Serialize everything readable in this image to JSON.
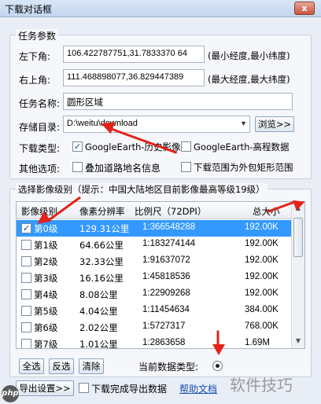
{
  "window": {
    "title": "下载对话框",
    "close_label": "x"
  },
  "task": {
    "legend": "任务参数",
    "bottom_left_label": "左下角:",
    "bottom_left_value": "106.422787751,31.7833370 64",
    "bottom_left_hint": "(最小经度,最小纬度)",
    "top_right_label": "右上角:",
    "top_right_value": "111.468898077,36.829447389",
    "top_right_hint": "(最大经度,最大纬度)",
    "name_label": "任务名称:",
    "name_value": "圆形区域",
    "dir_label": "存储目录:",
    "dir_value": "D:\\weitu\\download",
    "browse_label": "浏览>>",
    "type_label": "下载类型:",
    "type_option_1": "GoogleEarth-历史影像",
    "type_option_2": "GoogleEarth-高程数据",
    "other_label": "其他选项:",
    "other_option_1": "叠加道路地名信息",
    "other_option_2": "下载范围为外包矩形范围"
  },
  "levels": {
    "legend": "选择影像级别（提示：中国大陆地区目前影像最高等级19级）",
    "columns": [
      "影像级别",
      "像素分辨率",
      "比例尺（72DPI）",
      "总大小"
    ],
    "rows": [
      {
        "level": "第0级",
        "res": "129.31公里",
        "scale": "1:366548288",
        "size": "192.00K",
        "checked": true,
        "selected": true
      },
      {
        "level": "第1级",
        "res": "64.66公里",
        "scale": "1:183274144",
        "size": "192.00K",
        "checked": false,
        "selected": false
      },
      {
        "level": "第2级",
        "res": "32.33公里",
        "scale": "1:91637072",
        "size": "192.00K",
        "checked": false,
        "selected": false
      },
      {
        "level": "第3级",
        "res": "16.16公里",
        "scale": "1:45818536",
        "size": "192.00K",
        "checked": false,
        "selected": false
      },
      {
        "level": "第4级",
        "res": "8.08公里",
        "scale": "1:22909268",
        "size": "192.00K",
        "checked": false,
        "selected": false
      },
      {
        "level": "第5级",
        "res": "4.04公里",
        "scale": "1:11454634",
        "size": "384.00K",
        "checked": false,
        "selected": false
      },
      {
        "level": "第6级",
        "res": "2.02公里",
        "scale": "1:5727317",
        "size": "768.00K",
        "checked": false,
        "selected": false
      },
      {
        "level": "第7级",
        "res": "1.01公里",
        "scale": "1:2863658",
        "size": "1.69M",
        "checked": false,
        "selected": false
      }
    ],
    "select_all": "全选",
    "invert": "反选",
    "clear": "清除",
    "data_type_label": "当前数据类型:"
  },
  "footer": {
    "export_settings": "导出设置>>",
    "export_after_label": "下载完成导出数据",
    "help_link": "帮助文档"
  },
  "watermark": {
    "text": "软件技巧",
    "logo": "php"
  },
  "colors": {
    "selection": "#3399ff",
    "arrow": "#e2231a",
    "link": "#1a4fb3"
  }
}
